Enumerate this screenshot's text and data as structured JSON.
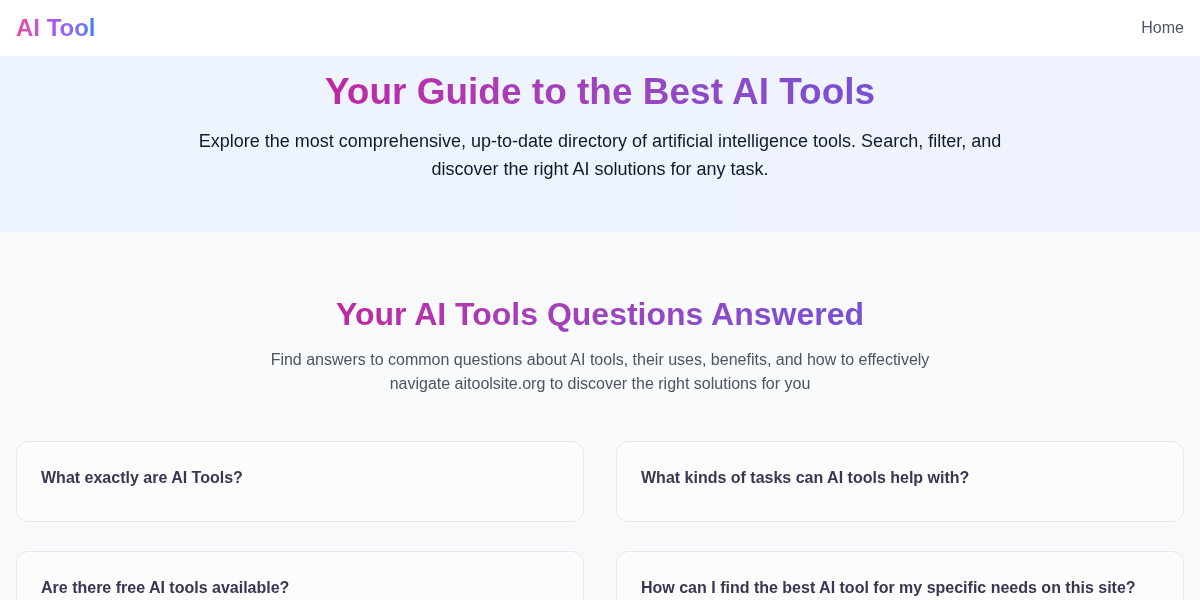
{
  "header": {
    "logo": "AI Tool",
    "nav": [
      {
        "label": "Home"
      }
    ]
  },
  "hero": {
    "title": "Your Guide to the Best AI Tools",
    "description": "Explore the most comprehensive, up-to-date directory of artificial intelligence tools. Search, filter, and discover the right AI solutions for any task."
  },
  "faq": {
    "title": "Your AI Tools Questions Answered",
    "subtitle": "Find answers to common questions about AI tools, their uses, benefits, and how to effectively navigate aitoolsite.org to discover the right solutions for you",
    "items": [
      {
        "question": "What exactly are AI Tools?"
      },
      {
        "question": "What kinds of tasks can AI tools help with?"
      },
      {
        "question": "Are there free AI tools available?"
      },
      {
        "question": "How can I find the best AI tool for my specific needs on this site?"
      }
    ]
  }
}
